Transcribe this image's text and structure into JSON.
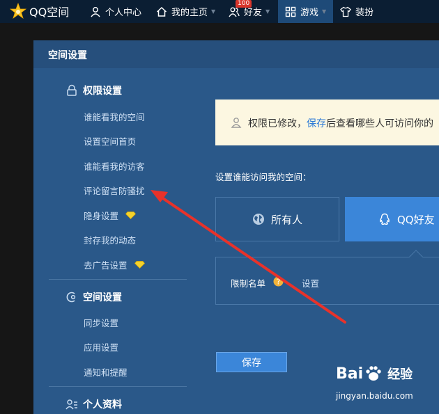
{
  "topnav": {
    "logo_text": "QQ空间",
    "items": [
      {
        "label": "个人中心"
      },
      {
        "label": "我的主页"
      },
      {
        "label": "好友",
        "badge": "100"
      },
      {
        "label": "游戏"
      },
      {
        "label": "装扮"
      }
    ]
  },
  "dialog": {
    "title": "空间设置"
  },
  "sidebar": {
    "sections": [
      {
        "title": "权限设置",
        "icon": "lock-icon",
        "items": [
          {
            "label": "谁能看我的空间"
          },
          {
            "label": "设置空间首页"
          },
          {
            "label": "谁能看我的访客"
          },
          {
            "label": "评论留言防骚扰"
          },
          {
            "label": "隐身设置",
            "icon": "diamond-icon"
          },
          {
            "label": "封存我的动态"
          },
          {
            "label": "去广告设置",
            "icon": "diamond-icon"
          }
        ]
      },
      {
        "title": "空间设置",
        "icon": "space-icon",
        "items": [
          {
            "label": "同步设置"
          },
          {
            "label": "应用设置"
          },
          {
            "label": "通知和提醒"
          }
        ]
      },
      {
        "title": "个人资料",
        "icon": "profile-icon",
        "items": []
      }
    ]
  },
  "main": {
    "notice": {
      "prefix": "权限已修改，",
      "link": "保存",
      "suffix": "后查看哪些人可访问你的"
    },
    "access_label": "设置谁能访问我的空间：",
    "options": [
      {
        "label": "所有人",
        "icon": "globe-icon",
        "selected": false
      },
      {
        "label": "QQ好友",
        "icon": "qq-icon",
        "selected": true
      }
    ],
    "limit": {
      "label": "限制名单",
      "set_link": "设置"
    },
    "save_label": "保存"
  },
  "watermark": {
    "brand_pre": "Bai",
    "brand_post": "经验",
    "url": "jingyan.baidu.com"
  },
  "colors": {
    "nav_bg": "#0b1e33",
    "panel_bg": "#2a5889",
    "accent": "#3b86d9",
    "arrow": "#e8322a"
  }
}
